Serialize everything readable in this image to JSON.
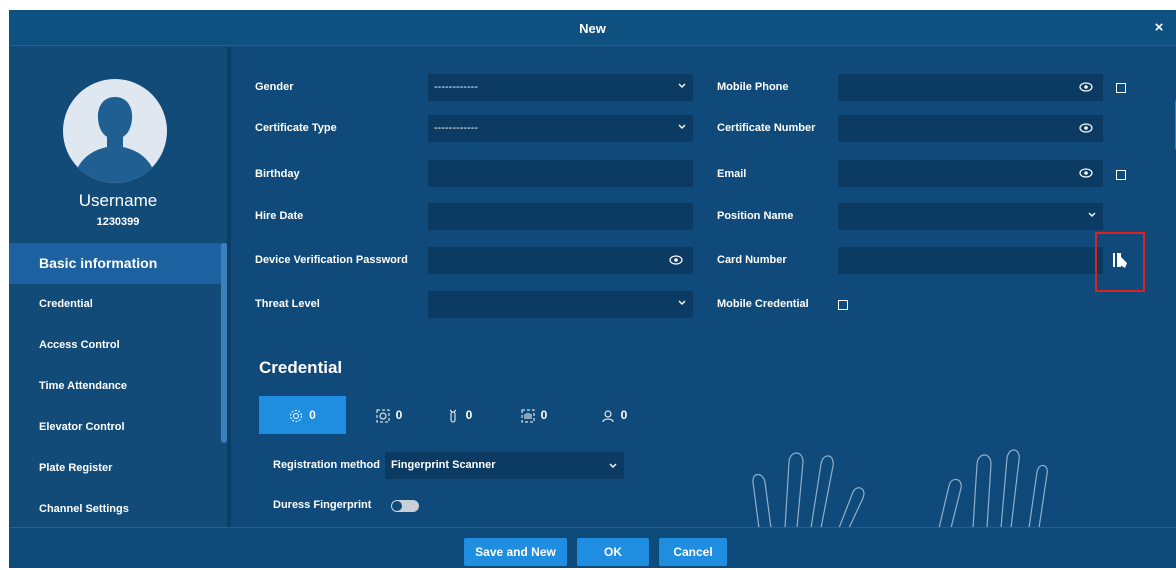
{
  "window": {
    "title": "New",
    "close_label": "×"
  },
  "profile": {
    "username": "Username",
    "id": "1230399"
  },
  "sidebar": {
    "items": [
      {
        "label": "Basic information",
        "active": true
      },
      {
        "label": "Credential"
      },
      {
        "label": "Access Control"
      },
      {
        "label": "Time Attendance"
      },
      {
        "label": "Elevator Control"
      },
      {
        "label": "Plate Register"
      },
      {
        "label": "Channel Settings"
      }
    ]
  },
  "form": {
    "gender": {
      "label": "Gender",
      "value": "------------"
    },
    "certificate_type": {
      "label": "Certificate Type",
      "value": "------------"
    },
    "birthday": {
      "label": "Birthday",
      "value": ""
    },
    "hire_date": {
      "label": "Hire Date",
      "value": ""
    },
    "device_password": {
      "label": "Device Verification Password",
      "value": ""
    },
    "threat_level": {
      "label": "Threat Level",
      "value": ""
    },
    "mobile_phone": {
      "label": "Mobile Phone",
      "value": ""
    },
    "certificate_number": {
      "label": "Certificate Number",
      "value": ""
    },
    "email": {
      "label": "Email",
      "value": ""
    },
    "position_name": {
      "label": "Position Name",
      "value": ""
    },
    "card_number": {
      "label": "Card Number",
      "value": ""
    },
    "mobile_credential": {
      "label": "Mobile Credential"
    }
  },
  "credential": {
    "title": "Credential",
    "tabs": [
      {
        "icon": "fingerprint-icon",
        "count": "0"
      },
      {
        "icon": "face-icon",
        "count": "0"
      },
      {
        "icon": "finger-vein-icon",
        "count": "0"
      },
      {
        "icon": "palm-icon",
        "count": "0"
      },
      {
        "icon": "person-icon",
        "count": "0"
      }
    ],
    "registration_label": "Registration method",
    "registration_value": "Fingerprint Scanner",
    "duress_label": "Duress Fingerprint"
  },
  "footer": {
    "save_new": "Save and New",
    "ok": "OK",
    "cancel": "Cancel"
  },
  "colors": {
    "window_bg": "#0f4a7a",
    "field_bg": "#0b3a63",
    "accent": "#1f8de0",
    "highlight_border": "#e02020"
  }
}
